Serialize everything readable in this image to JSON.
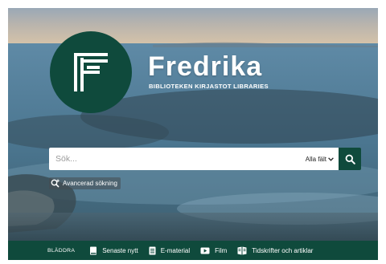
{
  "brand": {
    "name": "Fredrika",
    "subtitle": "BIBLIOTEKEN KIRJASTOT LIBRARIES"
  },
  "search": {
    "placeholder": "Sök...",
    "value": "",
    "field_selected": "Alla fält",
    "field_select_icon": "chevron-down-icon",
    "button_icon": "search-icon"
  },
  "advanced_search": {
    "label": "Avancerad sökning",
    "icon": "search-plus-icon"
  },
  "browse_bar": {
    "label": "BLÄDDRA",
    "items": [
      {
        "label": "Senaste nytt",
        "icon": "book-icon"
      },
      {
        "label": "E-material",
        "icon": "document-icon"
      },
      {
        "label": "Film",
        "icon": "film-icon"
      },
      {
        "label": "Tidskrifter och artiklar",
        "icon": "magazine-icon"
      }
    ]
  },
  "colors": {
    "brand_green": "#0f4a3c",
    "text_white": "#ffffff"
  }
}
